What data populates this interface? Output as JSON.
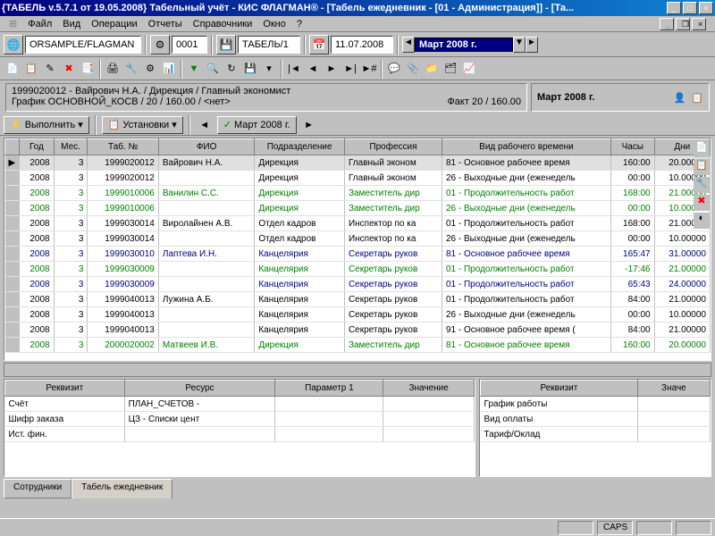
{
  "title": "{ТАБЕЛЬ v.5.7.1 от 19.05.2008} Табельный учёт - КИС ФЛАГМАН® - [Табель ежедневник - [01 - Администрация]] - [Та...",
  "menu": [
    "Файл",
    "Вид",
    "Операции",
    "Отчеты",
    "Справочники",
    "Окно",
    "?"
  ],
  "sysicon": "⊞",
  "tb": {
    "db": "ORSAMPLE/FLAGMAN",
    "org": "0001",
    "tabel": "ТАБЕЛЬ/1",
    "date": "11.07.2008",
    "period": "Март 2008 г."
  },
  "info": {
    "line1": "1999020012 - Вайрович Н.А.   /   Дирекция   /   Главный экономист",
    "line2": "График ОСНОВНОЙ_КОСВ / 20 / 160.00 / <нет>",
    "fact": "Факт 20 / 160.00",
    "period": "Март 2008 г."
  },
  "actions": {
    "exec": "Выполнить",
    "setup": "Установки",
    "period": "Март 2008 г."
  },
  "cols": [
    "Год",
    "Мес.",
    "Таб. №",
    "ФИО",
    "Подразделение",
    "Профессия",
    "Вид рабочего времени",
    "Часы",
    "Дни"
  ],
  "rows": [
    {
      "c": "",
      "y": "2008",
      "m": "3",
      "n": "1999020012",
      "f": "Вайрович Н.А.",
      "d": "Дирекция",
      "p": "Главный эконом",
      "v": "81 - Основное рабочее время",
      "h": "160:00",
      "dn": "20.00000"
    },
    {
      "c": "",
      "y": "2008",
      "m": "3",
      "n": "1999020012",
      "f": "",
      "d": "Дирекция",
      "p": "Главный эконом",
      "v": "26 - Выходные дни (еженедель",
      "h": "00:00",
      "dn": "10.00000"
    },
    {
      "c": "g",
      "y": "2008",
      "m": "3",
      "n": "1999010006",
      "f": "Ванилин С.С.",
      "d": "Дирекция",
      "p": "Заместитель дир",
      "v": "01 - Продолжительность работ",
      "h": "168:00",
      "dn": "21.00000"
    },
    {
      "c": "g",
      "y": "2008",
      "m": "3",
      "n": "1999010006",
      "f": "",
      "d": "Дирекция",
      "p": "Заместитель дир",
      "v": "26 - Выходные дни (еженедель",
      "h": "00:00",
      "dn": "10.00000"
    },
    {
      "c": "",
      "y": "2008",
      "m": "3",
      "n": "1999030014",
      "f": "Виролайнен А.В.",
      "d": "Отдел кадров",
      "p": "Инспектор по ка",
      "v": "01 - Продолжительность работ",
      "h": "168:00",
      "dn": "21.00000"
    },
    {
      "c": "",
      "y": "2008",
      "m": "3",
      "n": "1999030014",
      "f": "",
      "d": "Отдел кадров",
      "p": "Инспектор по ка",
      "v": "26 - Выходные дни (еженедель",
      "h": "00:00",
      "dn": "10.00000"
    },
    {
      "c": "b",
      "y": "2008",
      "m": "3",
      "n": "1999030010",
      "f": "Лаптева И.Н.",
      "d": "Канцелярия",
      "p": "Секретарь руков",
      "v": "81 - Основное рабочее время",
      "h": "165:47",
      "dn": "31.00000"
    },
    {
      "c": "g",
      "y": "2008",
      "m": "3",
      "n": "1999030009",
      "f": "",
      "d": "Канцелярия",
      "p": "Секретарь руков",
      "v": "01 - Продолжительность работ",
      "h": "-17:46",
      "dn": "21.00000"
    },
    {
      "c": "b",
      "y": "2008",
      "m": "3",
      "n": "1999030009",
      "f": "",
      "d": "Канцелярия",
      "p": "Секретарь руков",
      "v": "01 - Продолжительность работ",
      "h": "65:43",
      "dn": "24.00000"
    },
    {
      "c": "",
      "y": "2008",
      "m": "3",
      "n": "1999040013",
      "f": "Лужина А.Б.",
      "d": "Канцелярия",
      "p": "Секретарь руков",
      "v": "01 - Продолжительность работ",
      "h": "84:00",
      "dn": "21.00000"
    },
    {
      "c": "",
      "y": "2008",
      "m": "3",
      "n": "1999040013",
      "f": "",
      "d": "Канцелярия",
      "p": "Секретарь руков",
      "v": "26 - Выходные дни (еженедель",
      "h": "00:00",
      "dn": "10.00000"
    },
    {
      "c": "",
      "y": "2008",
      "m": "3",
      "n": "1999040013",
      "f": "",
      "d": "Канцелярия",
      "p": "Секретарь руков",
      "v": "91 - Основное рабочее время (",
      "h": "84:00",
      "dn": "21.00000"
    },
    {
      "c": "g",
      "y": "2008",
      "m": "3",
      "n": "2000020002",
      "f": "Матвеев И.В.",
      "d": "Дирекция",
      "p": "Заместитель дир",
      "v": "81 - Основное рабочее время",
      "h": "160:00",
      "dn": "20.00000"
    }
  ],
  "bcols1": [
    "Реквизит",
    "Ресурс",
    "Параметр 1",
    "Значение"
  ],
  "brows1": [
    {
      "r": "Счёт",
      "res": "ПЛАН_СЧЕТОВ -"
    },
    {
      "r": "Шифр заказа",
      "res": "ЦЗ - Списки цент"
    },
    {
      "r": "Ист. фин."
    }
  ],
  "bcols2": [
    "Реквизит",
    "Значе"
  ],
  "brows2": [
    "График работы",
    "Вид оплаты",
    "Тариф/Оклад"
  ],
  "tabs": [
    "Сотрудники",
    "Табель ежедневник"
  ],
  "status": {
    "caps": "CAPS"
  }
}
